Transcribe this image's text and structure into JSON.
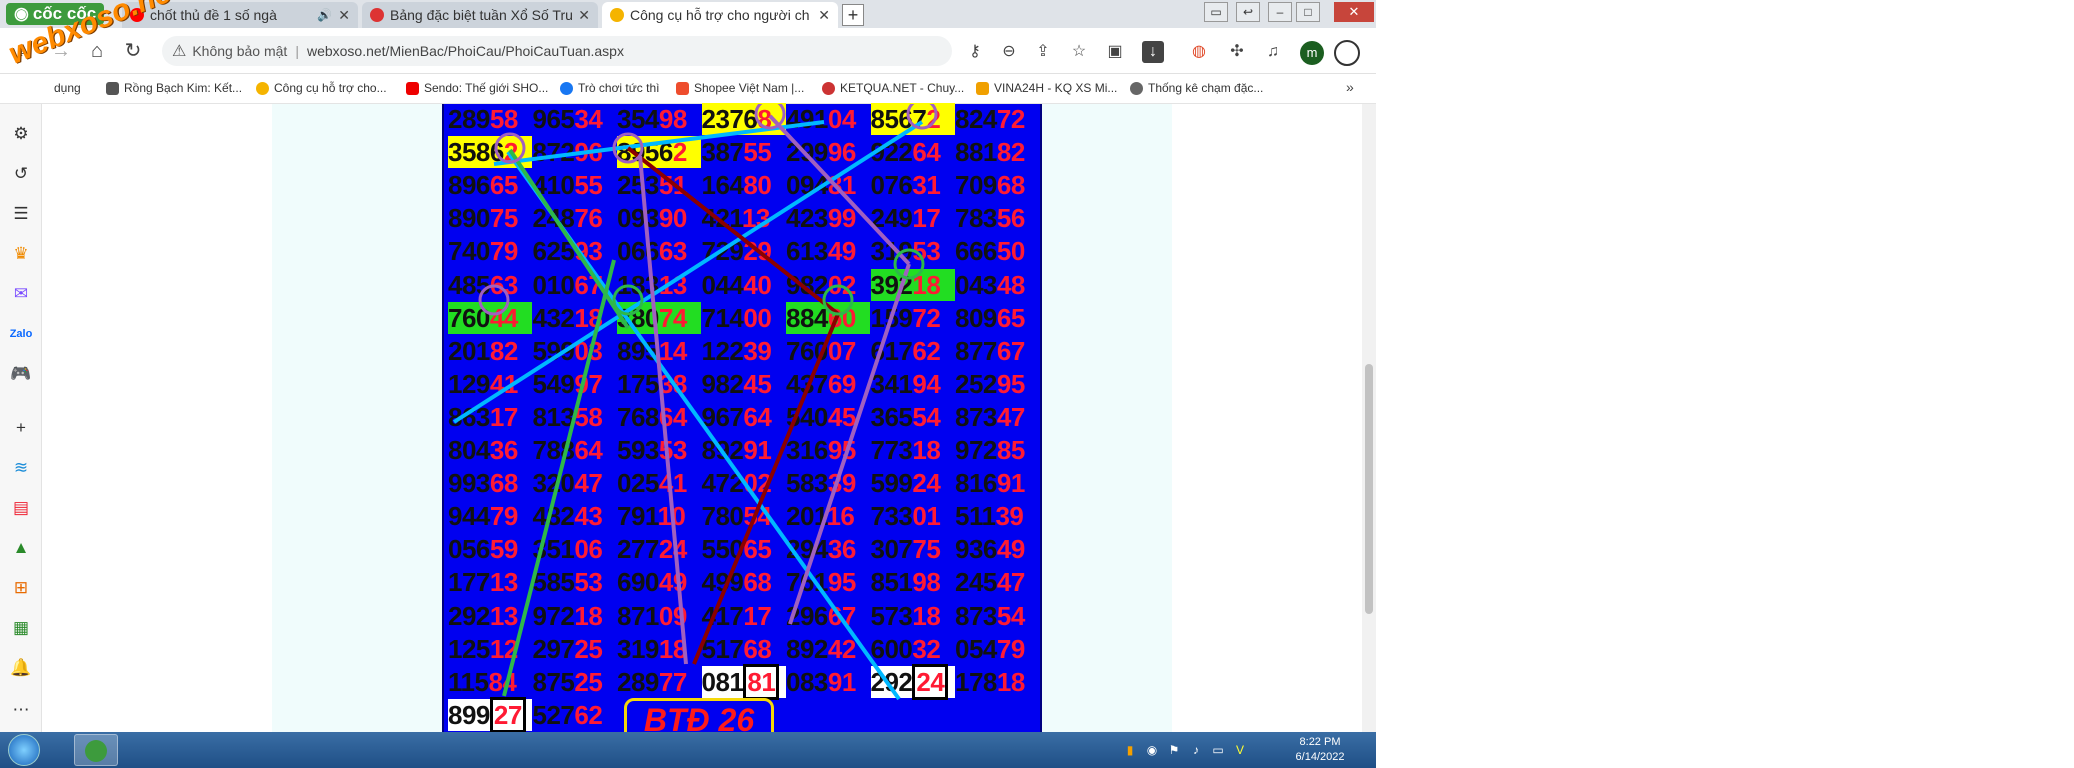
{
  "browser": {
    "brand": "cốc cốc",
    "tabs": [
      {
        "title": "chốt thủ đề 1 số ngà",
        "icon": "youtube-icon",
        "color": "#ff0000",
        "audio": "🔊"
      },
      {
        "title": "Bảng đặc biệt tuần Xổ Số Tru",
        "icon": "ketqua-icon",
        "color": "#d33"
      },
      {
        "title": "Công cụ hỗ trợ cho người ch",
        "icon": "xoso-icon",
        "color": "#f5b400"
      }
    ],
    "address": {
      "security": "Không bảo mật",
      "url": "webxoso.net/MienBac/PhoiCau/PhoiCauTuan.aspx"
    },
    "profile_initial": "m",
    "bookmarks": [
      {
        "label": "dụng",
        "color": "#888"
      },
      {
        "label": "Rồng Bạch Kim: Kết...",
        "color": "#555"
      },
      {
        "label": "Công cụ hỗ trợ cho...",
        "color": "#f5b400"
      },
      {
        "label": "Sendo: Thế giới SHO...",
        "color": "#e00"
      },
      {
        "label": "Trò chơi tức thì",
        "color": "#1877f2"
      },
      {
        "label": "Shopee Việt Nam |...",
        "color": "#ee4d2d"
      },
      {
        "label": "KETQUA.NET - Chuy...",
        "color": "#c33"
      },
      {
        "label": "VINA24H - KQ XS Mi...",
        "color": "#f0a000"
      },
      {
        "label": "Thống kê chạm đặc...",
        "color": "#666"
      }
    ]
  },
  "watermark": "webxoso.net",
  "board": {
    "rows": [
      [
        [
          "289",
          "58"
        ],
        [
          "965",
          "34"
        ],
        [
          "354",
          "98"
        ],
        [
          "2376",
          "8"
        ],
        [
          "491",
          "04"
        ],
        [
          "8567",
          "2"
        ],
        [
          "824",
          "72"
        ]
      ],
      [
        [
          "3586",
          "2"
        ],
        [
          "872",
          "96"
        ],
        [
          "8956",
          "2"
        ],
        [
          "387",
          "55"
        ],
        [
          "299",
          "96"
        ],
        [
          "922",
          "64"
        ],
        [
          "881",
          "82"
        ]
      ],
      [
        [
          "896",
          "65"
        ],
        [
          "410",
          "55"
        ],
        [
          "253",
          "51"
        ],
        [
          "164",
          "80"
        ],
        [
          "094",
          "81"
        ],
        [
          "076",
          "31"
        ],
        [
          "709",
          "68"
        ]
      ],
      [
        [
          "890",
          "75"
        ],
        [
          "248",
          "76"
        ],
        [
          "093",
          "90"
        ],
        [
          "421",
          "13"
        ],
        [
          "423",
          "99"
        ],
        [
          "249",
          "17"
        ],
        [
          "783",
          "56"
        ]
      ],
      [
        [
          "740",
          "79"
        ],
        [
          "625",
          "93"
        ],
        [
          "066",
          "63"
        ],
        [
          "729",
          "29"
        ],
        [
          "613",
          "49"
        ],
        [
          "319",
          "53"
        ],
        [
          "666",
          "50"
        ]
      ],
      [
        [
          "485",
          "63"
        ],
        [
          "010",
          "67"
        ],
        [
          "183",
          "13"
        ],
        [
          "044",
          "40"
        ],
        [
          "982",
          "02"
        ],
        [
          "392",
          "18"
        ],
        [
          "043",
          "48"
        ]
      ],
      [
        [
          "760",
          "44"
        ],
        [
          "432",
          "18"
        ],
        [
          "380",
          "74"
        ],
        [
          "714",
          "00"
        ],
        [
          "884",
          "60"
        ],
        [
          "159",
          "72"
        ],
        [
          "809",
          "65"
        ]
      ],
      [
        [
          "201",
          "82"
        ],
        [
          "599",
          "03"
        ],
        [
          "895",
          "14"
        ],
        [
          "122",
          "39"
        ],
        [
          "760",
          "07"
        ],
        [
          "617",
          "62"
        ],
        [
          "877",
          "67"
        ]
      ],
      [
        [
          "129",
          "41"
        ],
        [
          "549",
          "97"
        ],
        [
          "175",
          "38"
        ],
        [
          "982",
          "45"
        ],
        [
          "437",
          "69"
        ],
        [
          "341",
          "94"
        ],
        [
          "252",
          "95"
        ]
      ],
      [
        [
          "863",
          "17"
        ],
        [
          "813",
          "58"
        ],
        [
          "768",
          "64"
        ],
        [
          "967",
          "64"
        ],
        [
          "540",
          "45"
        ],
        [
          "365",
          "54"
        ],
        [
          "873",
          "47"
        ]
      ],
      [
        [
          "804",
          "36"
        ],
        [
          "788",
          "64"
        ],
        [
          "593",
          "53"
        ],
        [
          "892",
          "91"
        ],
        [
          "316",
          "95"
        ],
        [
          "773",
          "18"
        ],
        [
          "972",
          "85"
        ]
      ],
      [
        [
          "993",
          "68"
        ],
        [
          "320",
          "47"
        ],
        [
          "025",
          "41"
        ],
        [
          "472",
          "02"
        ],
        [
          "583",
          "39"
        ],
        [
          "599",
          "24"
        ],
        [
          "816",
          "91"
        ]
      ],
      [
        [
          "944",
          "79"
        ],
        [
          "482",
          "43"
        ],
        [
          "791",
          "10"
        ],
        [
          "780",
          "54"
        ],
        [
          "201",
          "16"
        ],
        [
          "733",
          "01"
        ],
        [
          "511",
          "39"
        ]
      ],
      [
        [
          "056",
          "59"
        ],
        [
          "351",
          "06"
        ],
        [
          "277",
          "24"
        ],
        [
          "550",
          "65"
        ],
        [
          "294",
          "36"
        ],
        [
          "307",
          "75"
        ],
        [
          "936",
          "49"
        ]
      ],
      [
        [
          "177",
          "13"
        ],
        [
          "585",
          "53"
        ],
        [
          "690",
          "49"
        ],
        [
          "499",
          "68"
        ],
        [
          "761",
          "95"
        ],
        [
          "851",
          "98"
        ],
        [
          "245",
          "47"
        ]
      ],
      [
        [
          "292",
          "13"
        ],
        [
          "972",
          "18"
        ],
        [
          "871",
          "09"
        ],
        [
          "417",
          "17"
        ],
        [
          "296",
          "67"
        ],
        [
          "573",
          "18"
        ],
        [
          "873",
          "54"
        ]
      ],
      [
        [
          "125",
          "12"
        ],
        [
          "297",
          "25"
        ],
        [
          "319",
          "18"
        ],
        [
          "517",
          "68"
        ],
        [
          "892",
          "42"
        ],
        [
          "600",
          "32"
        ],
        [
          "054",
          "79"
        ]
      ],
      [
        [
          "115",
          "84"
        ],
        [
          "875",
          "25"
        ],
        [
          "289",
          "77"
        ],
        [
          "081",
          "81"
        ],
        [
          "083",
          "91"
        ],
        [
          "292",
          "24"
        ],
        [
          "178",
          "18"
        ]
      ],
      [
        [
          "899",
          "27"
        ],
        [
          "527",
          "62"
        ],
        [
          "",
          ""
        ],
        [
          "",
          ""
        ],
        [
          "",
          ""
        ],
        [
          "",
          ""
        ],
        [
          "",
          ""
        ]
      ]
    ],
    "highlights": {
      "yellow": [
        [
          0,
          3
        ],
        [
          0,
          5
        ],
        [
          1,
          0
        ],
        [
          1,
          2
        ]
      ],
      "green": [
        [
          5,
          5
        ],
        [
          6,
          0
        ],
        [
          6,
          2
        ],
        [
          6,
          4
        ]
      ],
      "white": [
        [
          17,
          3
        ],
        [
          17,
          5
        ],
        [
          18,
          0
        ]
      ]
    },
    "boxed_suffix": [
      [
        17,
        3
      ],
      [
        17,
        5
      ],
      [
        18,
        0
      ]
    ],
    "result_label": "BTĐ 26",
    "line_colors": {
      "cyan": "#00b8ff",
      "green": "#2eb84a",
      "darkred": "#8b0000",
      "purple": "#a060c0"
    }
  },
  "taskbar": {
    "time": "8:22 PM",
    "date": "6/14/2022"
  }
}
